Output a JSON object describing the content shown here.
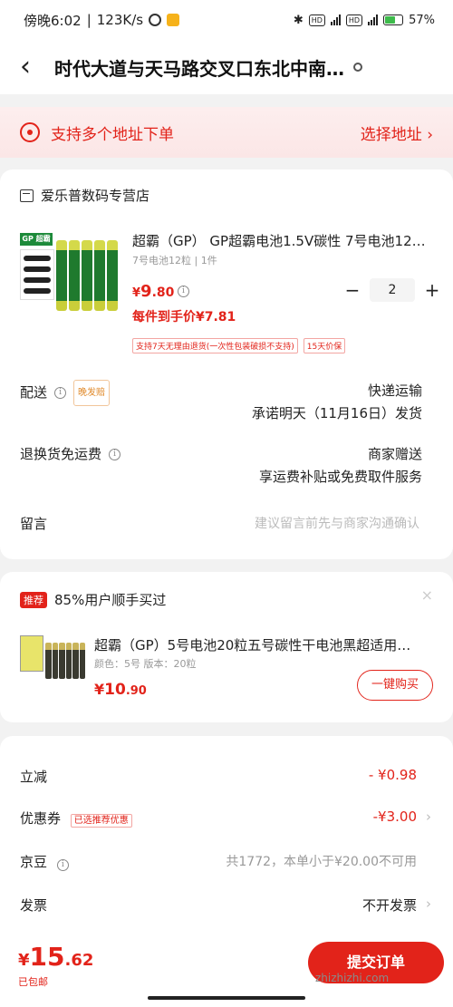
{
  "status_bar": {
    "time": "傍晚6:02",
    "speed": "123K/s",
    "battery": "57%"
  },
  "header": {
    "title": "时代大道与天马路交叉口东北中南…"
  },
  "multi_address": {
    "text": "支持多个地址下单",
    "action": "选择地址 ›"
  },
  "order": {
    "store_name": "爱乐普数码专营店",
    "product": {
      "badge": "GP 超霸",
      "title": "超霸（GP） GP超霸电池1.5V碳性 7号电池12粒装…",
      "spec": "7号电池12粒 | 1件",
      "price_symbol": "¥",
      "price_int": "9",
      "price_dec": ".80",
      "unit_price": "每件到手价¥7.81",
      "quantity": "2",
      "tags": [
        "支持7天无理由退货(一次性包装破损不支持)",
        "15天价保"
      ]
    },
    "delivery": {
      "label": "配送",
      "badge": "晚发赔",
      "method": "快递运输",
      "promise": "承诺明天（11月16日）发货"
    },
    "return_shipping": {
      "label": "退换货免运费",
      "value1": "商家赠送",
      "value2": "享运费补贴或免费取件服务"
    },
    "message": {
      "label": "留言",
      "placeholder": "建议留言前先与商家沟通确认"
    }
  },
  "recommend": {
    "tag": "推荐",
    "headline": "85%用户顺手买过",
    "close": "×",
    "title": "超霸（GP）5号电池20粒五号碳性干电池黑超适用…",
    "spec": "颜色：5号   版本：20粒",
    "price_symbol": "¥",
    "price_int": "10",
    "price_dec": ".90",
    "buy_label": "一键购买"
  },
  "summary": {
    "discount": {
      "label": "立减",
      "value": "- ¥0.98"
    },
    "coupon": {
      "label": "优惠券",
      "badge": "已选推荐优惠",
      "value": "-¥3.00"
    },
    "jingdou": {
      "label": "京豆",
      "value": "共1772，本单小于¥20.00不可用"
    },
    "invoice": {
      "label": "发票",
      "value": "不开发票"
    }
  },
  "bottom": {
    "total_symbol": "¥",
    "total_int": "15",
    "total_dec": ".62",
    "shipping": "已包邮",
    "submit": "提交订单",
    "watermark": "zhizhizhi.com"
  },
  "colors": {
    "accent": "#e2231a",
    "background": "#f2f2f2",
    "card": "#ffffff"
  }
}
